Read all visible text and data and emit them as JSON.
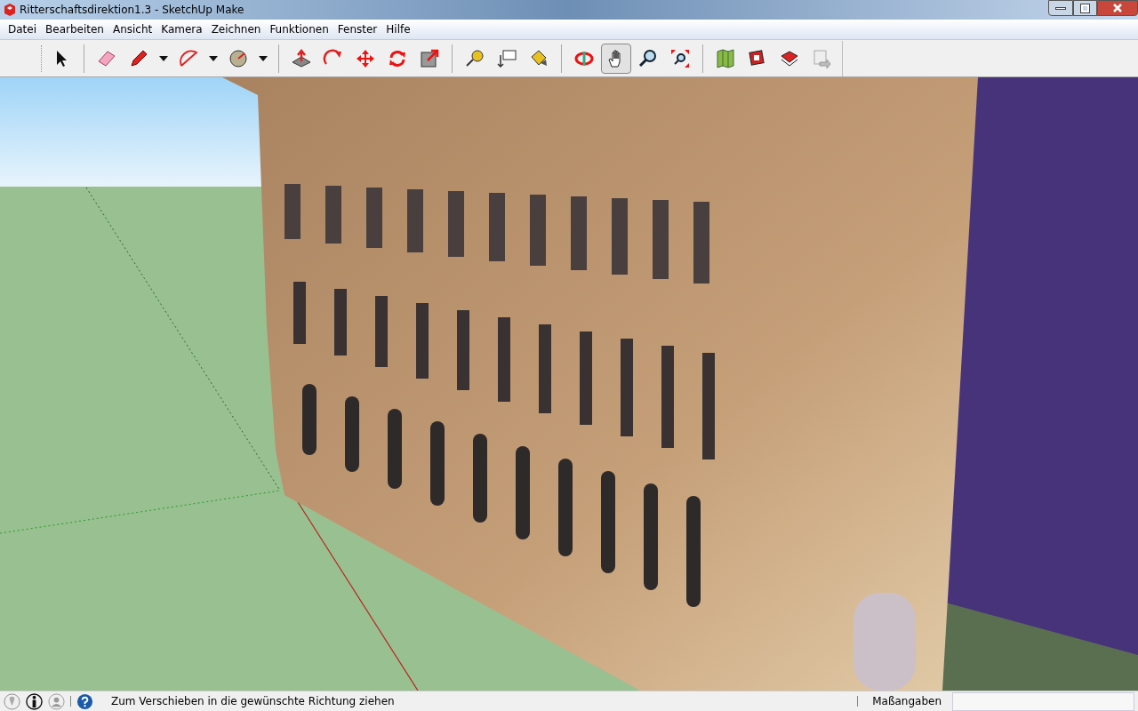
{
  "window": {
    "title": "Ritterschaftsdirektion1.3 - SketchUp Make"
  },
  "menu": [
    "Datei",
    "Bearbeiten",
    "Ansicht",
    "Kamera",
    "Zeichnen",
    "Funktionen",
    "Fenster",
    "Hilfe"
  ],
  "toolbar": {
    "groups": [
      [
        {
          "kind": "button",
          "selected": false
        }
      ],
      [
        {
          "kind": "button",
          "selected": false
        },
        {
          "kind": "split",
          "selected": false
        },
        {
          "kind": "split",
          "selected": false
        },
        {
          "kind": "split",
          "selected": false
        }
      ],
      [
        {
          "kind": "button",
          "selected": false
        },
        {
          "kind": "button",
          "selected": false
        },
        {
          "kind": "button",
          "selected": false
        },
        {
          "kind": "button",
          "selected": false
        },
        {
          "kind": "button",
          "selected": false
        }
      ],
      [
        {
          "kind": "button",
          "selected": false
        },
        {
          "kind": "button",
          "selected": false
        },
        {
          "kind": "button",
          "selected": false
        }
      ],
      [
        {
          "kind": "button",
          "selected": false
        },
        {
          "kind": "button",
          "selected": true
        },
        {
          "kind": "button",
          "selected": false
        },
        {
          "kind": "button",
          "selected": false
        }
      ],
      [
        {
          "kind": "button",
          "selected": false
        },
        {
          "kind": "button",
          "selected": false
        },
        {
          "kind": "button",
          "selected": false
        },
        {
          "kind": "button",
          "selected": false
        }
      ]
    ]
  },
  "status_bar": {
    "hint": "Zum Verschieben in die gewünschte Richtung ziehen",
    "measurements_label": "Maßangaben"
  }
}
